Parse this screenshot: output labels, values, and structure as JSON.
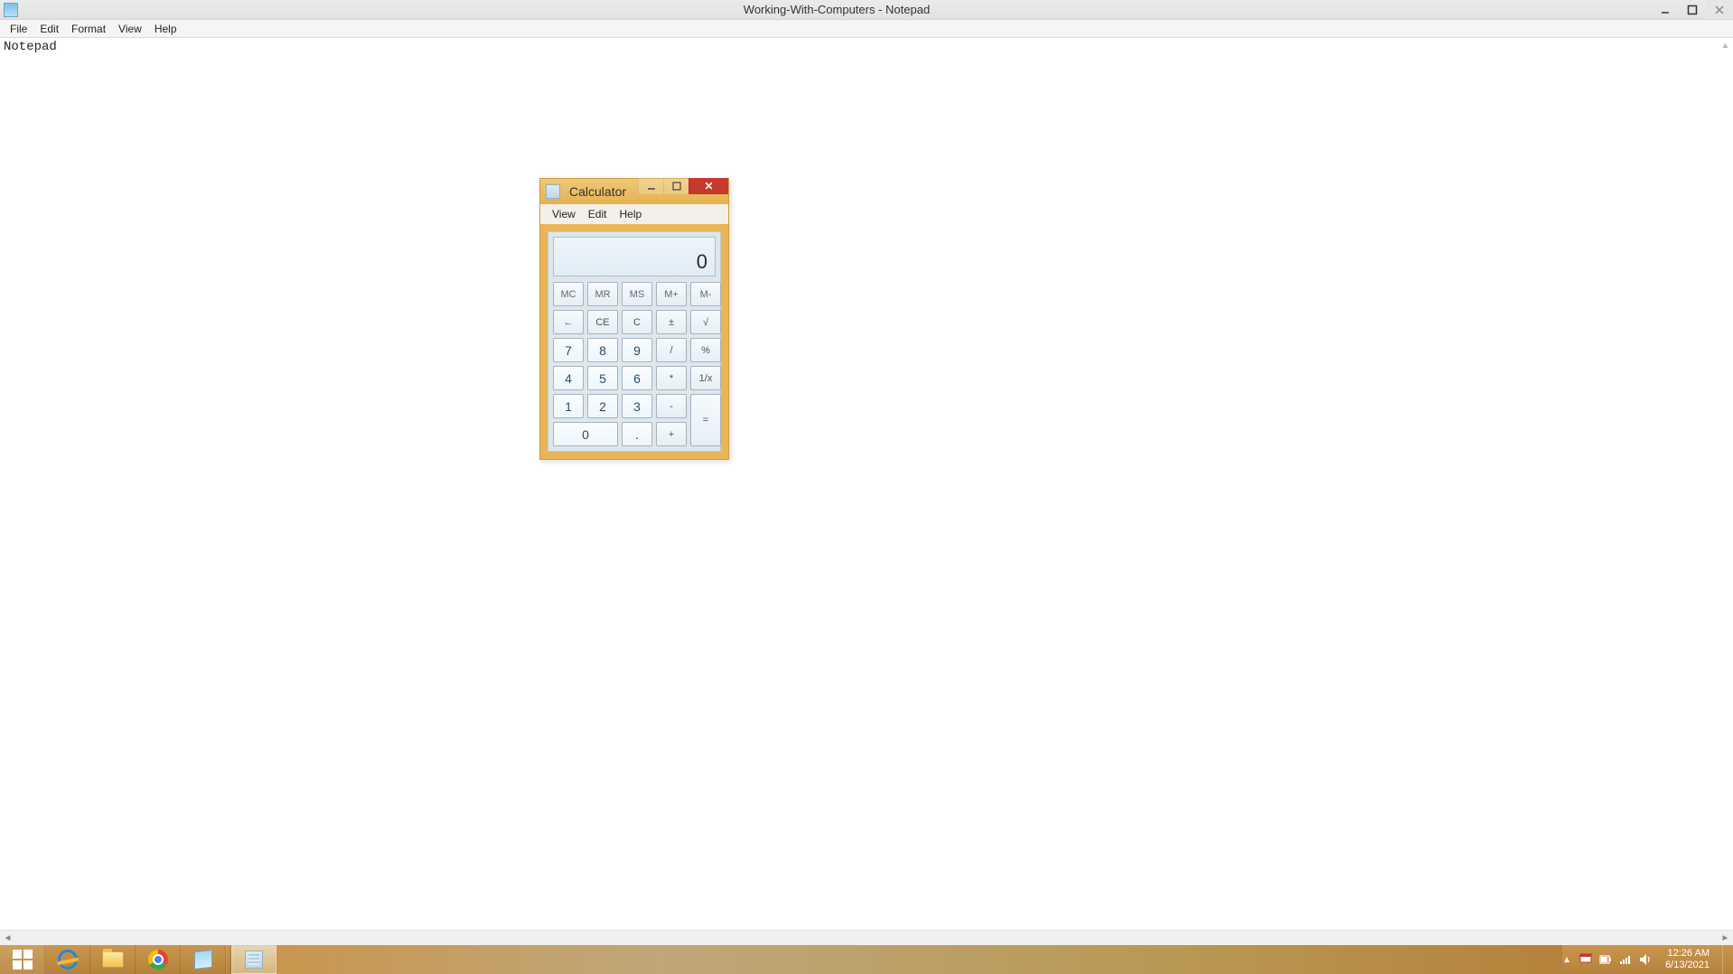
{
  "notepad": {
    "title": "Working-With-Computers - Notepad",
    "menus": {
      "file": "File",
      "edit": "Edit",
      "format": "Format",
      "view": "View",
      "help": "Help"
    },
    "content": "Notepad"
  },
  "calculator": {
    "title": "Calculator",
    "menus": {
      "view": "View",
      "edit": "Edit",
      "help": "Help"
    },
    "display": "0",
    "buttons": {
      "mc": "MC",
      "mr": "MR",
      "ms": "MS",
      "mplus": "M+",
      "mminus": "M-",
      "back": "←",
      "ce": "CE",
      "c": "C",
      "pm": "±",
      "sqrt": "√",
      "7": "7",
      "8": "8",
      "9": "9",
      "div": "/",
      "pct": "%",
      "4": "4",
      "5": "5",
      "6": "6",
      "mul": "*",
      "recip": "1/x",
      "1": "1",
      "2": "2",
      "3": "3",
      "sub": "-",
      "eq": "=",
      "0": "0",
      "dot": ".",
      "add": "+"
    }
  },
  "taskbar": {
    "time": "12:26 AM",
    "date": "6/13/2021"
  }
}
